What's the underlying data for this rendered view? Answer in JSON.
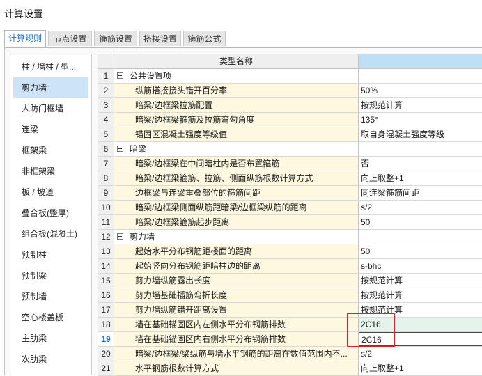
{
  "window": {
    "title": "计算设置"
  },
  "tabs": [
    {
      "label": "计算规则",
      "active": true
    },
    {
      "label": "节点设置",
      "active": false
    },
    {
      "label": "箍筋设置",
      "active": false
    },
    {
      "label": "搭接设置",
      "active": false
    },
    {
      "label": "箍筋公式",
      "active": false
    }
  ],
  "sidebar": {
    "selected_index": 1,
    "items": [
      {
        "label": "柱 / 墙柱 / 型..."
      },
      {
        "label": "剪力墙"
      },
      {
        "label": "人防门框墙"
      },
      {
        "label": "连梁"
      },
      {
        "label": "框架梁"
      },
      {
        "label": "非框架梁"
      },
      {
        "label": "板 / 坡道"
      },
      {
        "label": "叠合板(整厚)"
      },
      {
        "label": "组合板(混凝土)"
      },
      {
        "label": "预制柱"
      },
      {
        "label": "预制梁"
      },
      {
        "label": "预制墙"
      },
      {
        "label": "空心楼盖板"
      },
      {
        "label": "主肋梁"
      },
      {
        "label": "次肋梁"
      }
    ]
  },
  "grid": {
    "header": {
      "name_col": "类型名称"
    },
    "active_row": 19,
    "rows": [
      {
        "num": "1",
        "group": true,
        "name": "公共设置项",
        "value": ""
      },
      {
        "num": "2",
        "group": false,
        "name": "纵筋搭接接头错开百分率",
        "value": "50%"
      },
      {
        "num": "3",
        "group": false,
        "name": "暗梁/边框梁拉筋配置",
        "value": "按规范计算"
      },
      {
        "num": "4",
        "group": false,
        "name": "暗梁/边框梁箍筋及拉筋弯勾角度",
        "value": "135°"
      },
      {
        "num": "5",
        "group": false,
        "name": "锚固区混凝土强度等级值",
        "value": "取自身混凝土强度等级"
      },
      {
        "num": "6",
        "group": true,
        "name": "暗梁",
        "value": ""
      },
      {
        "num": "7",
        "group": false,
        "name": "暗梁/边框梁在中间暗柱内是否布置箍筋",
        "value": "否"
      },
      {
        "num": "8",
        "group": false,
        "name": "暗梁/边框梁箍筋、拉筋、侧面纵筋根数计算方式",
        "value": "向上取整+1"
      },
      {
        "num": "9",
        "group": false,
        "name": "边框梁与连梁重叠部位的箍筋间距",
        "value": "同连梁箍筋间距"
      },
      {
        "num": "10",
        "group": false,
        "name": "暗梁/边框梁侧面纵筋距暗梁/边框梁纵筋的距离",
        "value": "s/2"
      },
      {
        "num": "11",
        "group": false,
        "name": "暗梁/边框梁箍筋起步距离",
        "value": "50"
      },
      {
        "num": "12",
        "group": true,
        "name": "剪力墙",
        "value": ""
      },
      {
        "num": "13",
        "group": false,
        "name": "起始水平分布钢筋距楼面的距离",
        "value": "50"
      },
      {
        "num": "14",
        "group": false,
        "name": "起始竖向分布钢筋距暗柱边的距离",
        "value": "s-bhc"
      },
      {
        "num": "15",
        "group": false,
        "name": "剪力墙纵筋露出长度",
        "value": "按规范计算"
      },
      {
        "num": "16",
        "group": false,
        "name": "剪力墙基础插筋弯折长度",
        "value": "按规范计算"
      },
      {
        "num": "17",
        "group": false,
        "name": "剪力墙纵筋错开距离设置",
        "value": "按规范计算"
      },
      {
        "num": "18",
        "group": false,
        "name": "墙在基础锚固区内左侧水平分布钢筋排数",
        "value": "2C16",
        "green": true
      },
      {
        "num": "19",
        "group": false,
        "name": "墙在基础锚固区内右侧水平分布钢筋排数",
        "value": "2C16",
        "selected": true
      },
      {
        "num": "20",
        "group": false,
        "name": "暗梁/边框梁/梁纵筋与墙水平钢筋的距离在数值范围内不...",
        "value": "s/2"
      },
      {
        "num": "21",
        "group": false,
        "name": "水平钢筋根数计算方式",
        "value": "向上取整+1"
      }
    ]
  },
  "colors": {
    "tab_active_text": "#1f6fc5",
    "sidebar_selected": "#cde3f7",
    "name_cell_bg": "#fdf8df",
    "value_header_bg": "#bfe0f4",
    "highlight_green": "#e4f4ec",
    "annotation_red": "#e02020"
  }
}
